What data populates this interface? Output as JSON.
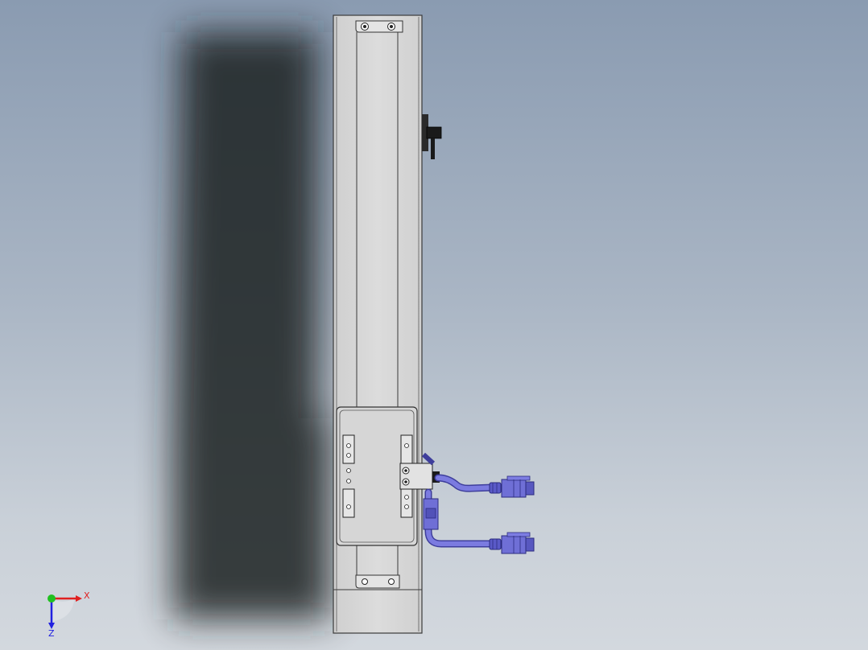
{
  "viewport": {
    "background_top": "#8a9bb1",
    "background_bottom": "#d3d8de"
  },
  "model": {
    "body_color": "#d8d8d8",
    "edge_color": "#3a3a3a",
    "cable_color": "#6f6fd6",
    "cable_dark": "#3e3e9c",
    "bracket_color": "#2a2a2a"
  },
  "triad": {
    "x_label": "X",
    "z_label": "Z",
    "x_color": "#e02020",
    "y_color": "#20c020",
    "z_color": "#2020e0"
  }
}
